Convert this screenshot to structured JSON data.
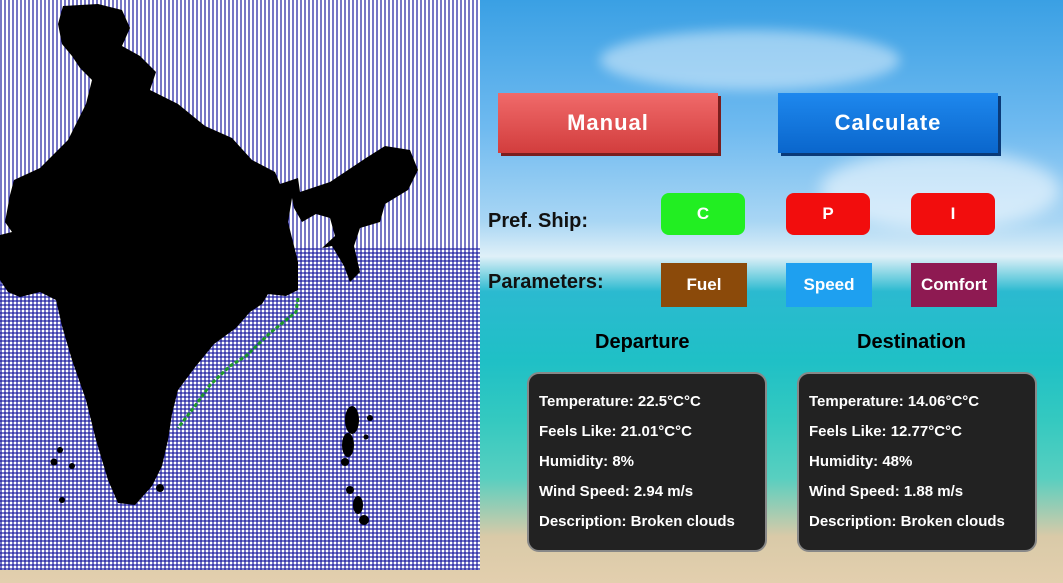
{
  "buttons": {
    "manual": "Manual",
    "calculate": "Calculate"
  },
  "pref_ship": {
    "label": "Pref. Ship:",
    "options": [
      {
        "label": "C",
        "color": "#22ee22"
      },
      {
        "label": "P",
        "color": "#f20d0d"
      },
      {
        "label": "I",
        "color": "#f20d0d"
      }
    ]
  },
  "parameters": {
    "label": "Parameters:",
    "options": [
      {
        "label": "Fuel",
        "color": "#8b4a0a"
      },
      {
        "label": "Speed",
        "color": "#1ea0f0"
      },
      {
        "label": "Comfort",
        "color": "#8e1a52"
      }
    ]
  },
  "departure": {
    "title": "Departure",
    "rows": [
      "Temperature: 22.5°C°C",
      "Feels Like: 21.01°C°C",
      "Humidity: 8%",
      "Wind Speed: 2.94 m/s",
      "Description: Broken clouds"
    ]
  },
  "destination": {
    "title": "Destination",
    "rows": [
      "Temperature: 14.06°C°C",
      "Feels Like: 12.77°C°C",
      "Humidity: 48%",
      "Wind Speed: 1.88 m/s",
      "Description: Broken clouds"
    ]
  },
  "colors": {
    "grid": "#1a1aa0",
    "land": "#000000",
    "route": "#1f9a2a"
  }
}
